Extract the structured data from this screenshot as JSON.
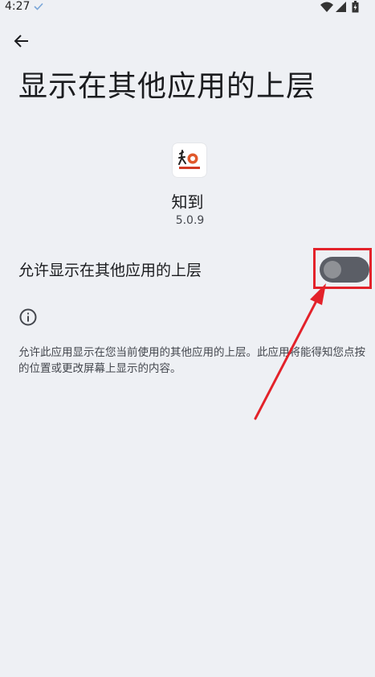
{
  "status_bar": {
    "time": "4:27"
  },
  "header": {
    "title": "显示在其他应用的上层"
  },
  "app": {
    "name": "知到",
    "version": "5.0.9"
  },
  "permission": {
    "label": "允许显示在其他应用的上层",
    "enabled": false
  },
  "info": {
    "text": "允许此应用显示在您当前使用的其他应用的上层。此应用将能得知您点按的位置或更改屏幕上显示的内容。"
  },
  "icons": {
    "status": [
      "check-icon",
      "wifi-icon",
      "signal-icon",
      "battery-icon"
    ],
    "back": "arrow-left-icon",
    "info": "info-circle-icon",
    "app": "app-logo"
  },
  "colors": {
    "background": "#eef0f4",
    "toggle_track": "#5b5e66",
    "toggle_thumb": "#8f9196",
    "annotation": "#e3222a"
  }
}
